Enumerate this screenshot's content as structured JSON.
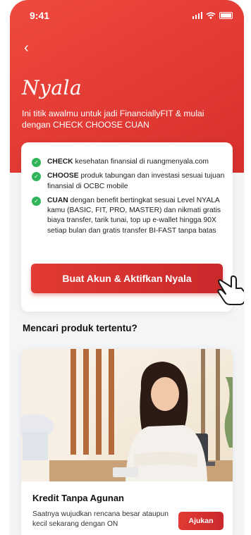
{
  "status_bar": {
    "time": "9:41"
  },
  "header": {
    "back_glyph": "‹",
    "logo_text": "Nyala",
    "tagline": "Ini titik awalmu untuk jadi FinanciallyFIT & mulai dengan CHECK CHOOSE CUAN"
  },
  "benefits": [
    {
      "keyword": "CHECK",
      "text": " kesehatan finansial di ruangmenyala.com"
    },
    {
      "keyword": "CHOOSE",
      "text": " produk tabungan dan investasi sesuai tujuan finansial di OCBC mobile"
    },
    {
      "keyword": "CUAN",
      "text": " dengan benefit bertingkat sesuai Level NYALA kamu (BASIC, FIT, PRO, MASTER) dan nikmati gratis biaya transfer, tarik tunai, top up e-wallet hingga 90X setiap bulan dan gratis transfer BI-FAST tanpa batas"
    }
  ],
  "cta_label": "Buat Akun & Aktifkan Nyala",
  "section_title": "Mencari produk tertentu?",
  "product": {
    "title": "Kredit Tanpa Agunan",
    "description": "Saatnya wujudkan rencana besar ataupun kecil sekarang dengan ON",
    "button_label": "Ajukan"
  },
  "colors": {
    "brand_red": "#e23a34",
    "check_green": "#2fb457"
  },
  "icons": {
    "back": "back-arrow-icon",
    "check": "check-circle-icon",
    "pointer": "pointer-hand-icon"
  }
}
